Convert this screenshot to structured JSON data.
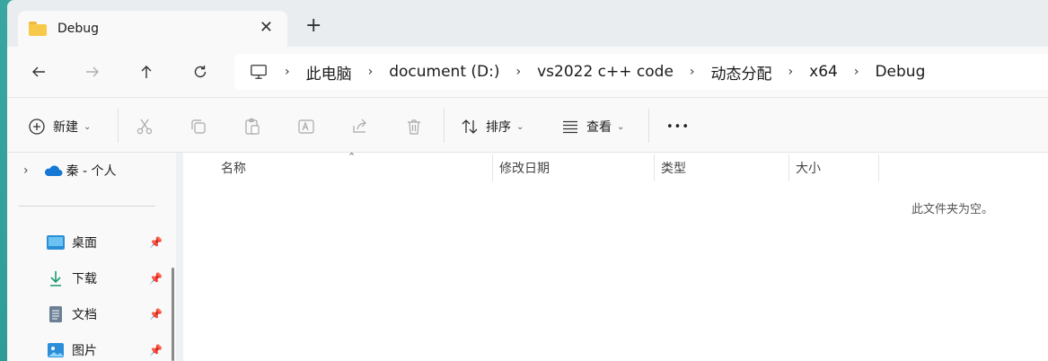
{
  "tab": {
    "title": "Debug",
    "close": "✕",
    "new_tab": "+"
  },
  "nav": {
    "back": "back-arrow",
    "forward": "forward-arrow",
    "up": "up-arrow",
    "refresh": "refresh"
  },
  "breadcrumb": [
    "此电脑",
    "document (D:)",
    "vs2022 c++ code",
    "动态分配",
    "x64",
    "Debug"
  ],
  "toolbar": {
    "new_label": "新建",
    "sort_label": "排序",
    "view_label": "查看",
    "more": "•••"
  },
  "sidebar": {
    "onedrive_label": "秦 - 个人",
    "items": [
      {
        "label": "桌面",
        "icon": "desktop-icon"
      },
      {
        "label": "下载",
        "icon": "download-icon"
      },
      {
        "label": "文档",
        "icon": "document-icon"
      },
      {
        "label": "图片",
        "icon": "pictures-icon"
      }
    ]
  },
  "columns": [
    "名称",
    "修改日期",
    "类型",
    "大小"
  ],
  "empty_message": "此文件夹为空。",
  "colors": {
    "accent": "#0067c0",
    "folder": "#f7c948",
    "desktop_wallpaper": "#3aa6a0"
  }
}
